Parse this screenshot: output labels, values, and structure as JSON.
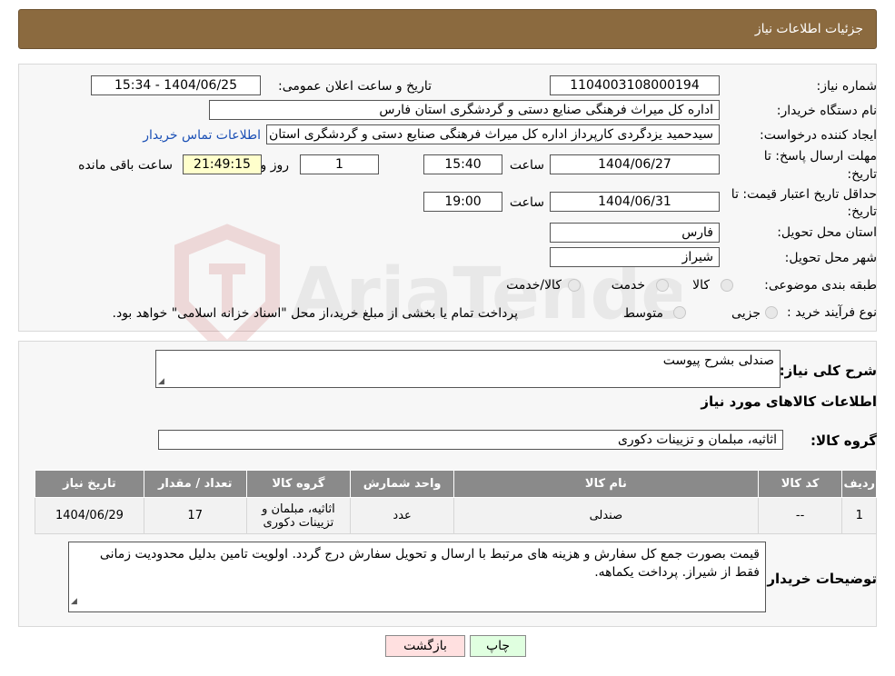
{
  "header": {
    "title": "جزئیات اطلاعات نیاز"
  },
  "form": {
    "need_number_label": "شماره نیاز:",
    "need_number": "1104003108000194",
    "announce_label": "تاریخ و ساعت اعلان عمومی:",
    "announce_value": "1404/06/25 - 15:34",
    "buyer_org_label": "نام دستگاه خریدار:",
    "buyer_org": "اداره کل میراث فرهنگی  صنایع دستی و گردشگری استان فارس",
    "creator_label": "ایجاد کننده درخواست:",
    "creator": "سیدحمید یزدگردی کارپرداز اداره کل میراث فرهنگی  صنایع دستی و گردشگری استان فارس",
    "contact_link": "اطلاعات تماس خریدار",
    "reply_deadline_label_1": "مهلت ارسال پاسخ: تا",
    "reply_deadline_label_2": "تاریخ:",
    "reply_date": "1404/06/27",
    "time_label": "ساعت",
    "reply_time": "15:40",
    "days_value": "1",
    "days_label": "روز و",
    "remaining_time": "21:49:15",
    "remaining_label": "ساعت باقی مانده",
    "validity_label_1": "حداقل تاریخ اعتبار قیمت: تا",
    "validity_label_2": "تاریخ:",
    "validity_date": "1404/06/31",
    "validity_time_label": "ساعت",
    "validity_time": "19:00",
    "province_label": "استان محل تحویل:",
    "province": "فارس",
    "city_label": "شهر محل تحویل:",
    "city": "شیراز",
    "category_label": "طبقه بندی موضوعی:",
    "category_options": [
      "کالا",
      "خدمت",
      "کالا/خدمت"
    ],
    "process_label": "نوع فرآیند خرید :",
    "process_options": [
      "جزیی",
      "متوسط"
    ],
    "process_note": "پرداخت تمام یا بخشی از مبلغ خرید،از محل \"اسناد خزانه اسلامی\" خواهد بود."
  },
  "details": {
    "summary_label": "شرح کلی نیاز:",
    "summary": "صندلی بشرح پیوست",
    "goods_info_title": "اطلاعات کالاهای مورد نیاز",
    "goods_group_label": "گروه کالا:",
    "goods_group": "اثاثیه، مبلمان و تزیینات دکوری"
  },
  "table": {
    "headers": [
      "ردیف",
      "کد کالا",
      "نام کالا",
      "واحد شمارش",
      "گروه کالا",
      "تعداد / مقدار",
      "تاریخ نیاز"
    ],
    "rows": [
      [
        "1",
        "--",
        "صندلی",
        "عدد",
        "اثاثیه، مبلمان و تزیینات دکوری",
        "17",
        "1404/06/29"
      ]
    ]
  },
  "buyer_notes": {
    "label": "توضیحات خریدار:",
    "text": "قیمت بصورت جمع کل سفارش و هزینه های مرتبط با ارسال و تحویل سفارش درج گردد. اولویت تامین بدلیل محدودیت زمانی فقط از شیراز. پرداخت یکماهه."
  },
  "buttons": {
    "print": "چاپ",
    "back": "بازگشت"
  },
  "watermark": {
    "text": "AriaTender.neT"
  },
  "colors": {
    "header": "#8b6a3f",
    "link": "#1a4fb5",
    "table_header": "#8a8a8a",
    "back_button": "#ffe0e0",
    "print_button": "#e0ffe0"
  }
}
